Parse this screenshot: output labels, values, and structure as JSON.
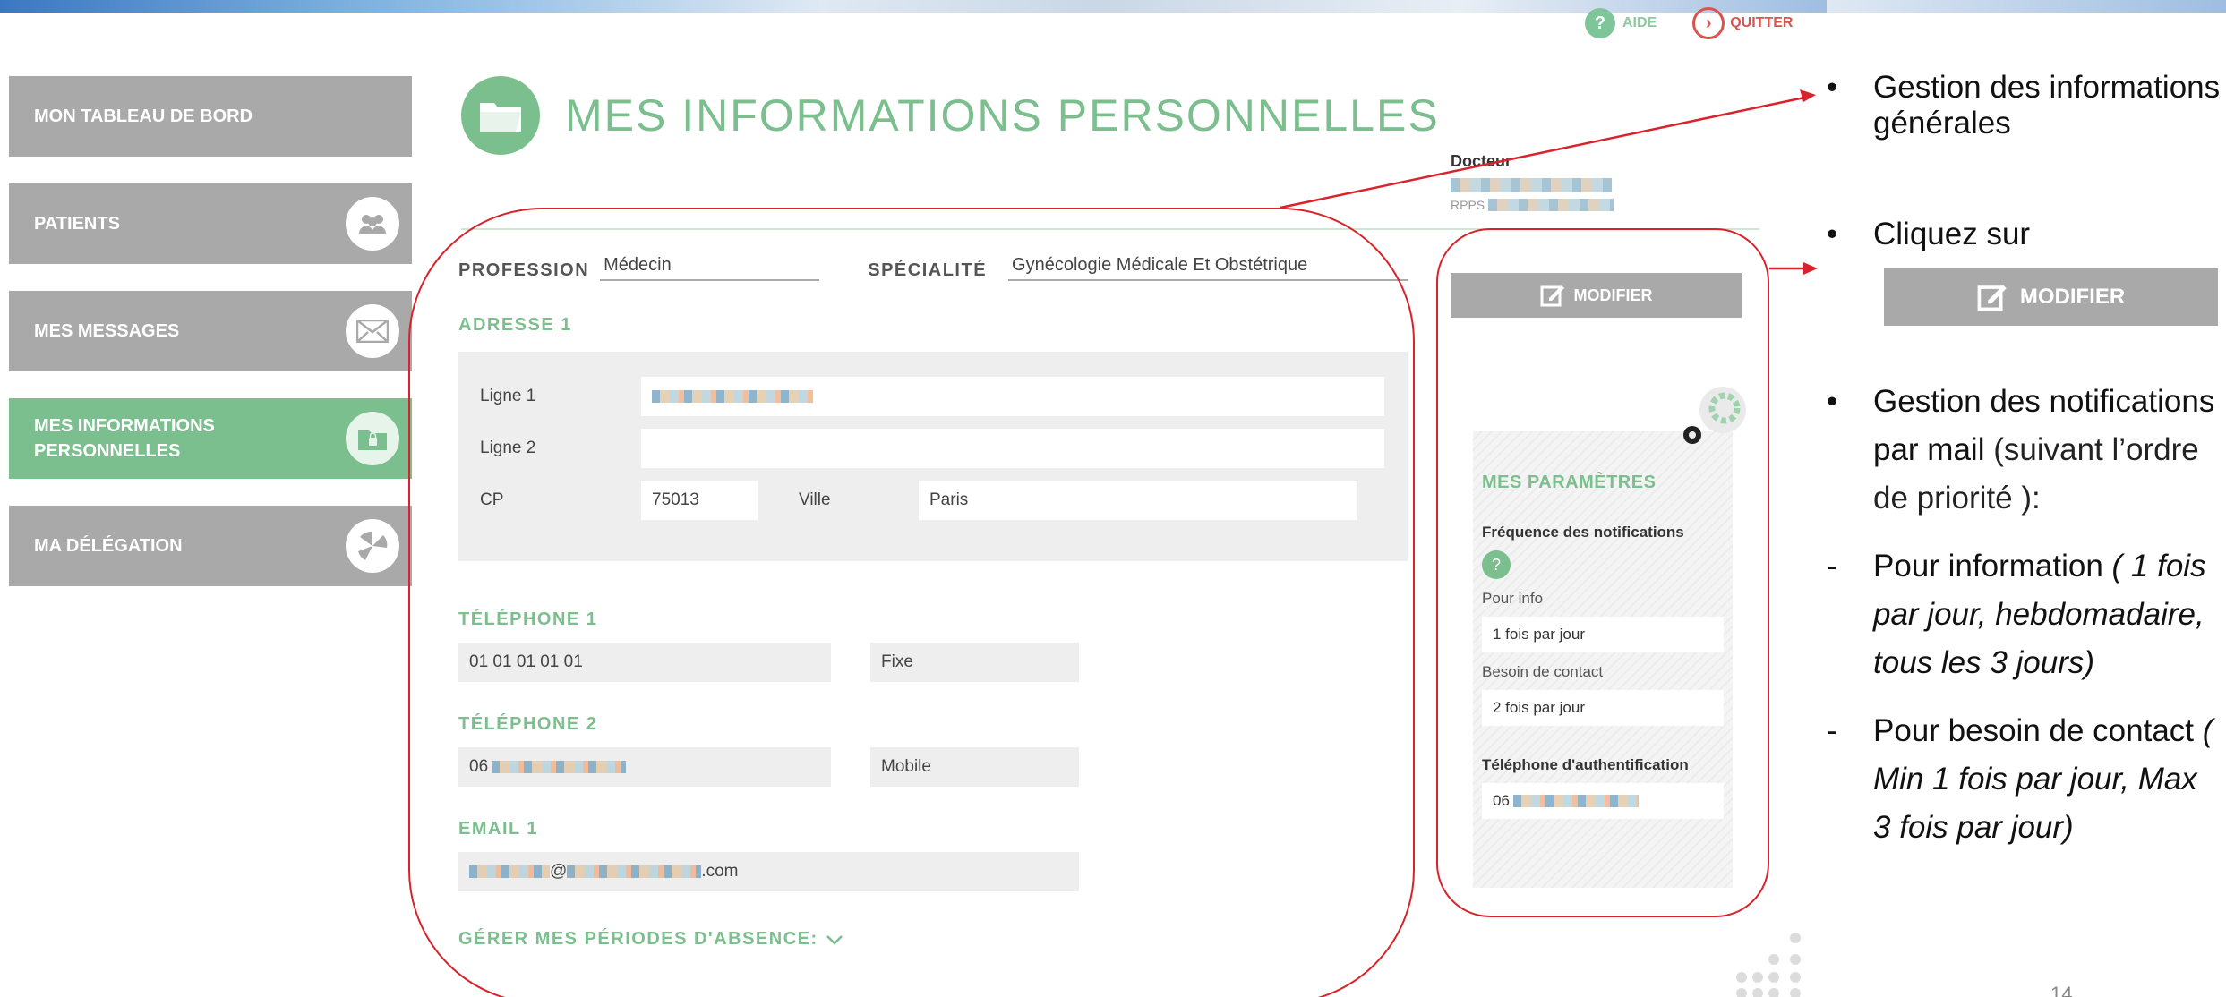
{
  "topbar": {
    "help_label": "AIDE",
    "help_icon": "?",
    "quit_label": "QUITTER"
  },
  "sidebar": {
    "items": [
      {
        "label": "MON TABLEAU DE BORD",
        "icon": ""
      },
      {
        "label": "PATIENTS",
        "icon": "group-icon"
      },
      {
        "label": "MES MESSAGES",
        "icon": "envelope-icon"
      },
      {
        "label": "MES INFORMATIONS PERSONNELLES",
        "icon": "folder-lock-icon"
      },
      {
        "label": "MA DÉLÉGATION",
        "icon": "delegation-icon"
      }
    ],
    "active_index": 3
  },
  "main": {
    "title": "MES INFORMATIONS PERSONNELLES",
    "doctor": {
      "title": "Docteur",
      "rpps_label": "RPPS"
    },
    "profession": {
      "label": "PROFESSION",
      "value": "Médecin"
    },
    "specialite": {
      "label": "SPÉCIALITÉ",
      "value": "Gynécologie Médicale Et Obstétrique"
    },
    "adresse": {
      "title": "ADRESSE 1",
      "ligne1_label": "Ligne 1",
      "ligne2_label": "Ligne 2",
      "cp_label": "CP",
      "cp_value": "75013",
      "ville_label": "Ville",
      "ville_value": "Paris"
    },
    "tel1": {
      "title": "TÉLÉPHONE 1",
      "value": "01 01 01 01 01",
      "type": "Fixe"
    },
    "tel2": {
      "title": "TÉLÉPHONE 2",
      "value": "06",
      "type": "Mobile"
    },
    "email": {
      "title": "EMAIL 1",
      "at": "@",
      "suffix": ".com"
    },
    "absence_label": "GÉRER MES PÉRIODES D'ABSENCE:"
  },
  "panel": {
    "modify_label": "MODIFIER",
    "params_title": "MES PARAMÈTRES",
    "freq_label": "Fréquence des notifications",
    "freq_help": "?",
    "info_label": "Pour info",
    "info_value": "1 fois par jour",
    "contact_label": "Besoin de contact",
    "contact_value": "2 fois par jour",
    "auth_label": "Téléphone d'authentification",
    "auth_value": "06"
  },
  "notes": {
    "bullet1": "Gestion des informations générales",
    "bullet2": "Cliquez sur",
    "button_label": "MODIFIER",
    "bullet3_bold": "Gestion des notifications par mail",
    "bullet3_light": "(suivant l’ordre de priorité ):",
    "dash1_bold": "Pour information",
    "dash1_italic": "( 1 fois par jour, hebdomadaire, tous les 3 jours)",
    "dash2_bold": "Pour besoin de contact",
    "dash2_italic": "( Min 1 fois par jour, Max 3 fois par jour)",
    "page": "14"
  },
  "colors": {
    "accent_green": "#7bbf8e",
    "sidebar_grey": "#a9a9a9",
    "annotation_red": "#d9232b",
    "quit_red": "#d9534f"
  }
}
